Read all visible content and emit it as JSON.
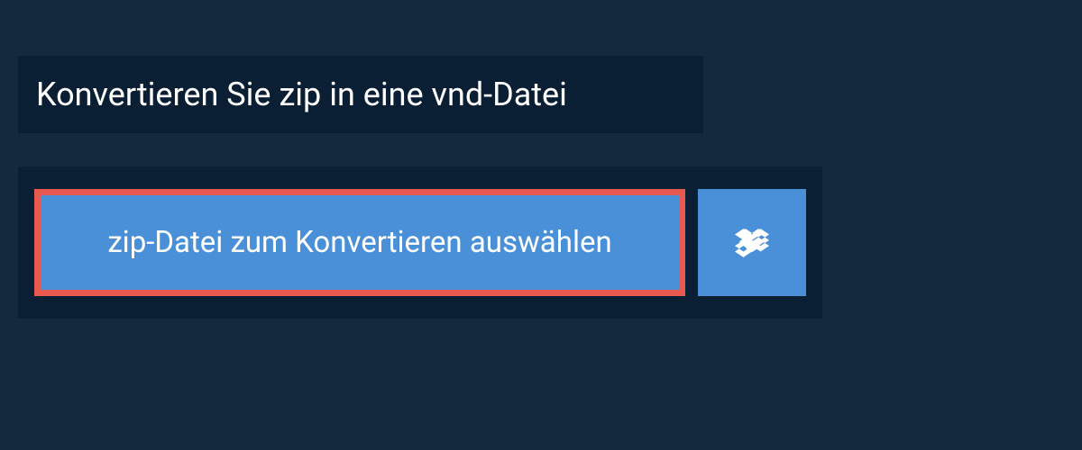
{
  "header": {
    "title": "Konvertieren Sie zip in eine vnd-Datei"
  },
  "converter": {
    "select_button_label": "zip-Datei zum Konvertieren auswählen",
    "dropbox_icon": "dropbox"
  },
  "colors": {
    "background": "#14293e",
    "panel": "#0a1f33",
    "button": "#4a90d9",
    "highlight_border": "#e85a4f",
    "text": "#ffffff"
  }
}
